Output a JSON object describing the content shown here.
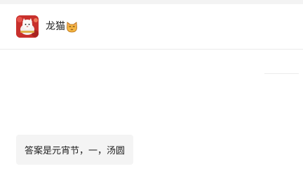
{
  "chat": {
    "contact_name": "龙猫",
    "contact_emoji_icon": "cat-face-icon",
    "avatar_icon": "avatar-image"
  },
  "messages": [
    {
      "text": "答案是元宵节，一，汤圆"
    }
  ],
  "colors": {
    "header_bg": "#ffffff",
    "bubble_bg": "#f4f4f4",
    "divider": "#ebebeb",
    "avatar_red": "#c8302c"
  }
}
